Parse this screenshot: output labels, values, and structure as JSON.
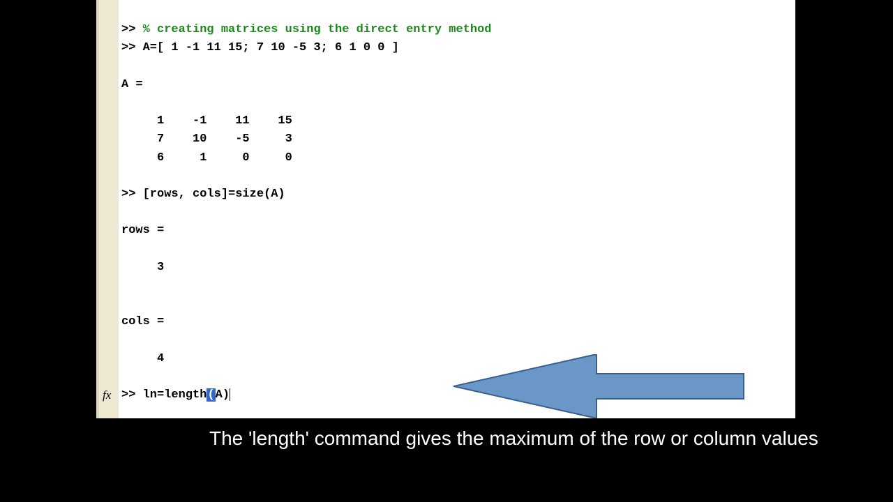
{
  "prompt": ">>",
  "lines": {
    "comment": "% creating matrices using the direct entry method",
    "defA": "A=[ 1 -1 11 15; 7 10 -5 3; 6 1 0 0 ]",
    "Aeq": "A =",
    "row1": "     1    -1    11    15",
    "row2": "     7    10    -5     3",
    "row3": "     6     1     0     0",
    "sizeCmd": "[rows, cols]=size(A)",
    "rowsLbl": "rows =",
    "rowsVal": "     3",
    "colsLbl": "cols =",
    "colsVal": "     4",
    "lenPre": "ln=length",
    "lenHi": "(",
    "lenPost": "A)"
  },
  "fx": "fx",
  "caption": "The 'length' command gives the maximum of the row or column values",
  "arrow": {
    "fill": "#6a96c8",
    "stroke": "#3a5f8a"
  }
}
